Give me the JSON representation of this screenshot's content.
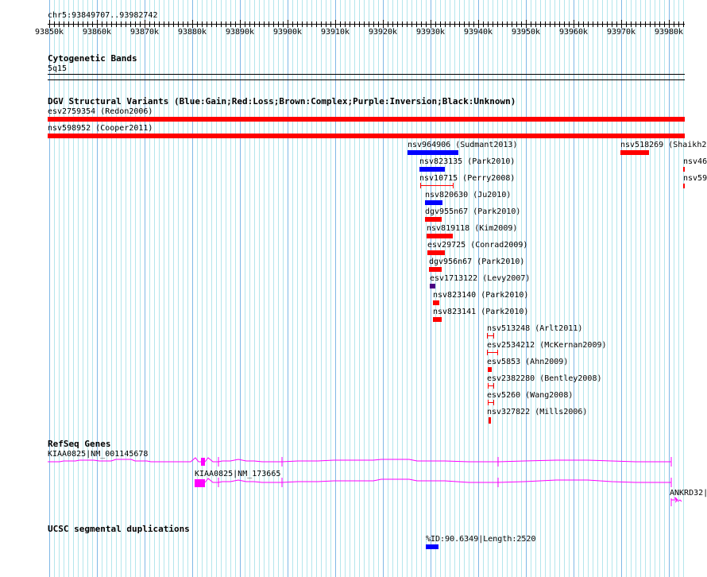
{
  "ruler": {
    "region": "chr5:93849707..93982742",
    "ticks": [
      "93850k",
      "93860k",
      "93870k",
      "93880k",
      "93890k",
      "93900k",
      "93910k",
      "93920k",
      "93930k",
      "93940k",
      "93950k",
      "93960k",
      "93970k",
      "93980k"
    ]
  },
  "cytoband": {
    "title": "Cytogenetic Bands",
    "band": "5q15"
  },
  "dgv": {
    "title": "DGV Structural Variants (Blue:Gain;Red:Loss;Brown:Complex;Purple:Inversion;Black:Unknown)",
    "features": [
      "esv2759354 (Redon2006)",
      "nsv598952 (Cooper2011)",
      "nsv964906 (Sudmant2013)",
      "nsv518269 (Shaikh20",
      "nsv823135 (Park2010)",
      "nsv46",
      "nsv10715 (Perry2008)",
      "nsv59",
      "nsv820630 (Ju2010)",
      "dgv955n67 (Park2010)",
      "nsv819118 (Kim2009)",
      "esv29725 (Conrad2009)",
      "dgv956n67 (Park2010)",
      "esv1713122 (Levy2007)",
      "nsv823140 (Park2010)",
      "nsv823141 (Park2010)",
      "nsv513248 (Arlt2011)",
      "esv2534212 (McKernan2009)",
      "esv5853 (Ahn2009)",
      "esv2382280 (Bentley2008)",
      "esv5260 (Wang2008)",
      "nsv327822 (Mills2006)"
    ]
  },
  "refseq": {
    "title": "RefSeq Genes",
    "genes": [
      "KIAA0825|NM_001145678",
      "KIAA0825|NM_173665",
      "ANKRD32|"
    ]
  },
  "segdup": {
    "title": "UCSC segmental duplications",
    "features": [
      "%ID:90.6349|Length:2520"
    ]
  },
  "colors": {
    "gain": "#0000ff",
    "loss": "#ff0000",
    "inversion": "#4b0082",
    "gene": "#ff00ff"
  }
}
